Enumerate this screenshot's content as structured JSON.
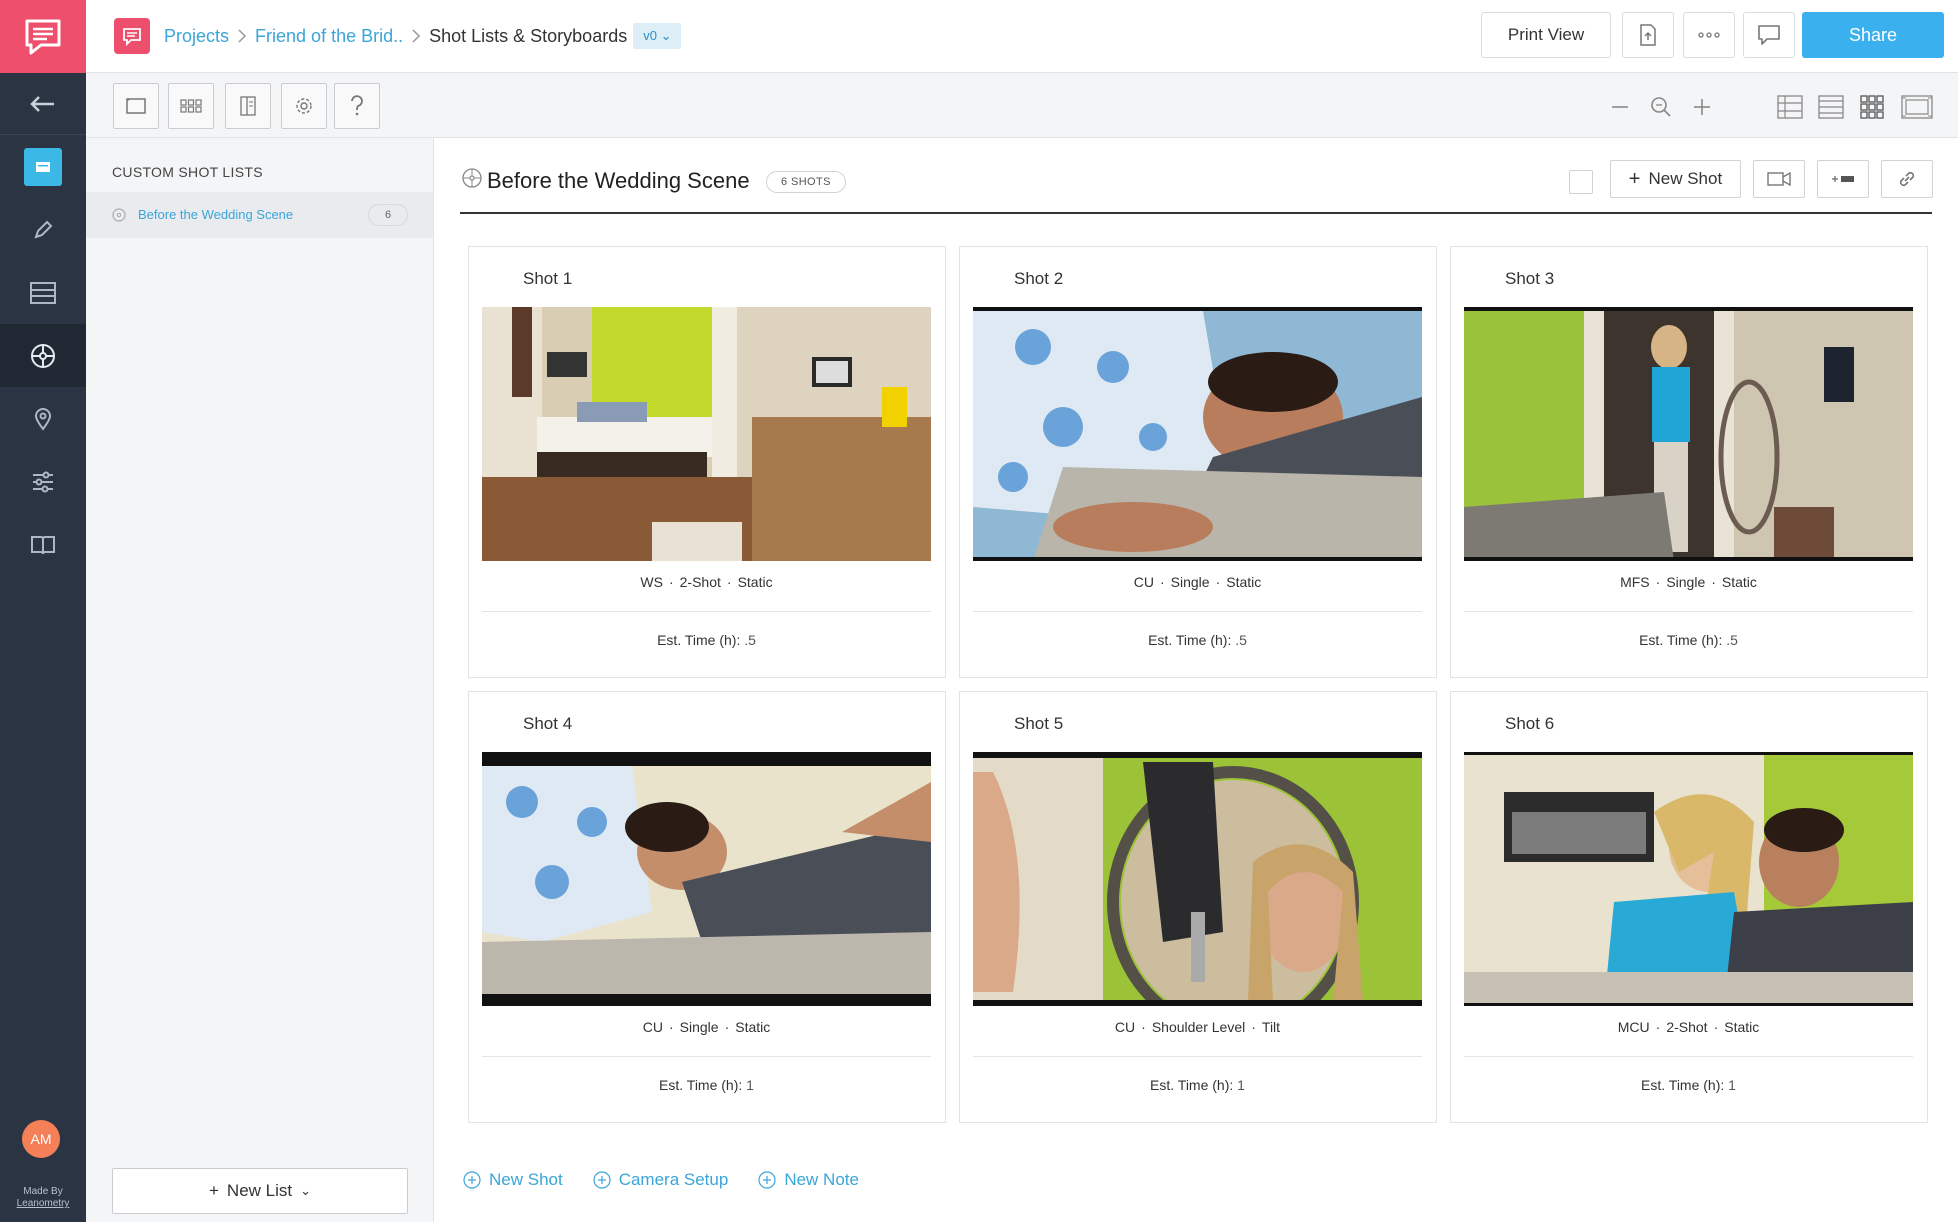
{
  "rail": {
    "avatar_initials": "AM",
    "made_by_line1": "Made By",
    "made_by_line2": "Leanometry",
    "items": [
      "back-arrow",
      "storyboard",
      "pencil",
      "list",
      "film-reel",
      "location-pin",
      "sliders",
      "book"
    ]
  },
  "header": {
    "breadcrumbs": [
      {
        "label": "Projects"
      },
      {
        "label": "Friend of the Brid.."
      },
      {
        "label": "Shot Lists & Storyboards"
      }
    ],
    "version": "v0",
    "print_view_label": "Print View",
    "share_label": "Share"
  },
  "sidebar": {
    "title": "CUSTOM SHOT LISTS",
    "lists": [
      {
        "label": "Before the Wedding Scene",
        "count": "6"
      }
    ],
    "new_list_label": "New List"
  },
  "scene": {
    "title": "Before the Wedding Scene",
    "shots_badge": "6 SHOTS",
    "new_shot_label": "New Shot"
  },
  "shots": [
    {
      "title": "Shot 1",
      "size": "WS",
      "type": "2-Shot",
      "movement": "Static",
      "time_label": "Est. Time (h):",
      "time": ".5"
    },
    {
      "title": "Shot 2",
      "size": "CU",
      "type": "Single",
      "movement": "Static",
      "time_label": "Est. Time (h):",
      "time": ".5"
    },
    {
      "title": "Shot 3",
      "size": "MFS",
      "type": "Single",
      "movement": "Static",
      "time_label": "Est. Time (h):",
      "time": ".5"
    },
    {
      "title": "Shot 4",
      "size": "CU",
      "type": "Single",
      "movement": "Static",
      "time_label": "Est. Time (h):",
      "time": "1"
    },
    {
      "title": "Shot 5",
      "size": "CU",
      "type": "Shoulder Level",
      "movement": "Tilt",
      "time_label": "Est. Time (h):",
      "time": "1"
    },
    {
      "title": "Shot 6",
      "size": "MCU",
      "type": "2-Shot",
      "movement": "Static",
      "time_label": "Est. Time (h):",
      "time": "1"
    }
  ],
  "bottom_actions": {
    "new_shot": "New Shot",
    "camera_setup": "Camera Setup",
    "new_note": "New Note"
  },
  "colors": {
    "brand": "#ee4f6c",
    "accent": "#3bb0ef",
    "link": "#3aa5d8",
    "rail": "#2b3442"
  }
}
